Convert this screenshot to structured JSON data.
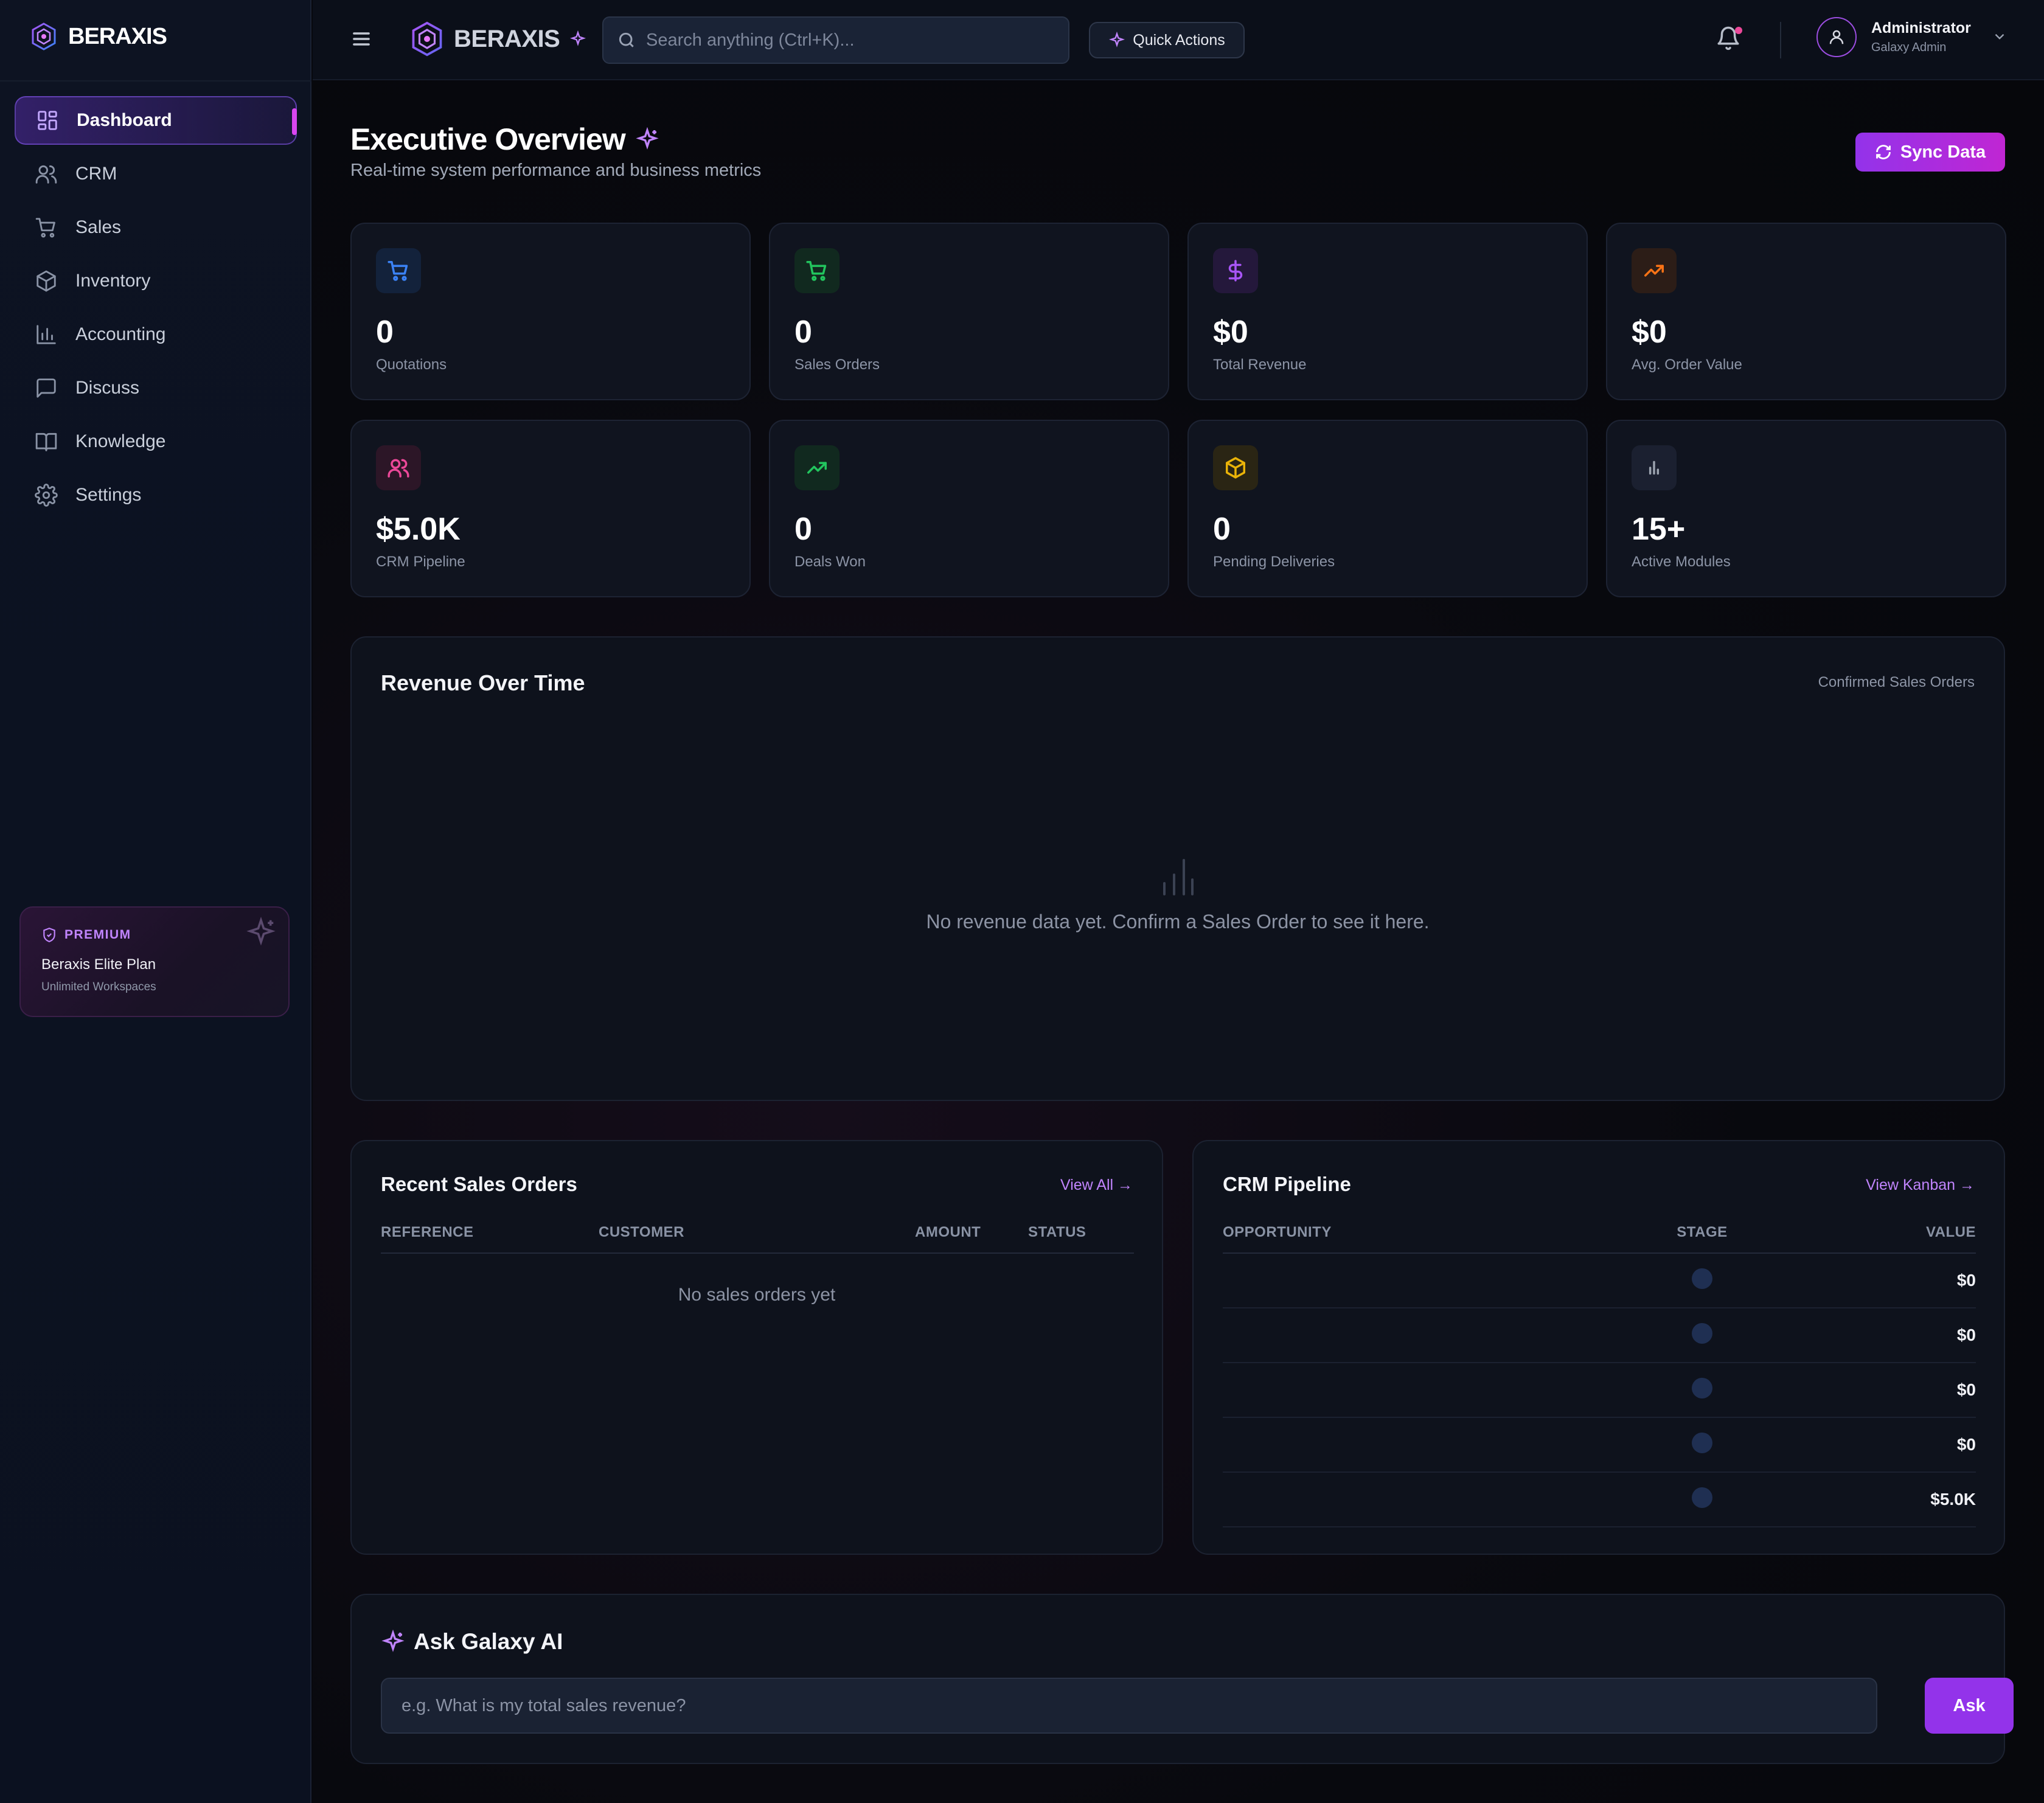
{
  "brand": {
    "name": "BERAXIS",
    "accent": "#9333ea"
  },
  "sidebar": {
    "items": [
      {
        "label": "Dashboard",
        "icon": "dashboard-icon",
        "active": true
      },
      {
        "label": "CRM",
        "icon": "users-icon"
      },
      {
        "label": "Sales",
        "icon": "cart-icon"
      },
      {
        "label": "Inventory",
        "icon": "box-icon"
      },
      {
        "label": "Accounting",
        "icon": "bar-chart-icon"
      },
      {
        "label": "Discuss",
        "icon": "chat-icon"
      },
      {
        "label": "Knowledge",
        "icon": "book-icon"
      },
      {
        "label": "Settings",
        "icon": "gear-icon"
      }
    ],
    "premium": {
      "tag": "PREMIUM",
      "plan": "Beraxis Elite Plan",
      "sub": "Unlimited Workspaces"
    }
  },
  "topbar": {
    "search_placeholder": "Search anything (Ctrl+K)...",
    "quick_actions": "Quick Actions",
    "user": {
      "name": "Administrator",
      "role": "Galaxy Admin"
    }
  },
  "header": {
    "title": "Executive Overview",
    "subtitle": "Real-time system performance and business metrics",
    "sync_label": "Sync Data"
  },
  "stats": [
    {
      "value": "0",
      "label": "Quotations",
      "icon": "cart-icon",
      "color": "#3b82f6"
    },
    {
      "value": "0",
      "label": "Sales Orders",
      "icon": "cart-icon",
      "color": "#22c55e"
    },
    {
      "value": "$0",
      "label": "Total Revenue",
      "icon": "dollar-icon",
      "color": "#a855f7"
    },
    {
      "value": "$0",
      "label": "Avg. Order Value",
      "icon": "trending-up-icon",
      "color": "#f97316"
    },
    {
      "value": "$5.0K",
      "label": "CRM Pipeline",
      "icon": "users-icon",
      "color": "#ec4899"
    },
    {
      "value": "0",
      "label": "Deals Won",
      "icon": "trending-up-icon",
      "color": "#22c55e"
    },
    {
      "value": "0",
      "label": "Pending Deliveries",
      "icon": "box-icon",
      "color": "#eab308"
    },
    {
      "value": "15+",
      "label": "Active Modules",
      "icon": "bar-chart-icon",
      "color": "#9ca3af"
    }
  ],
  "revenue": {
    "title": "Revenue Over Time",
    "caption": "Confirmed Sales Orders",
    "empty_message": "No revenue data yet. Confirm a Sales Order to see it here."
  },
  "recent_orders": {
    "title": "Recent Sales Orders",
    "view_all": "View All →",
    "columns": [
      "REFERENCE",
      "CUSTOMER",
      "AMOUNT",
      "STATUS"
    ],
    "empty_message": "No sales orders yet"
  },
  "crm_pipeline": {
    "title": "CRM Pipeline",
    "view_link": "View Kanban →",
    "columns": [
      "OPPORTUNITY",
      "STAGE",
      "VALUE"
    ],
    "rows": [
      {
        "opportunity": "",
        "value": "$0"
      },
      {
        "opportunity": "",
        "value": "$0"
      },
      {
        "opportunity": "",
        "value": "$0"
      },
      {
        "opportunity": "",
        "value": "$0"
      },
      {
        "opportunity": "",
        "value": "$5.0K"
      }
    ]
  },
  "ask_ai": {
    "title": "Ask Galaxy AI",
    "placeholder": "e.g. What is my total sales revenue?",
    "button": "Ask"
  }
}
